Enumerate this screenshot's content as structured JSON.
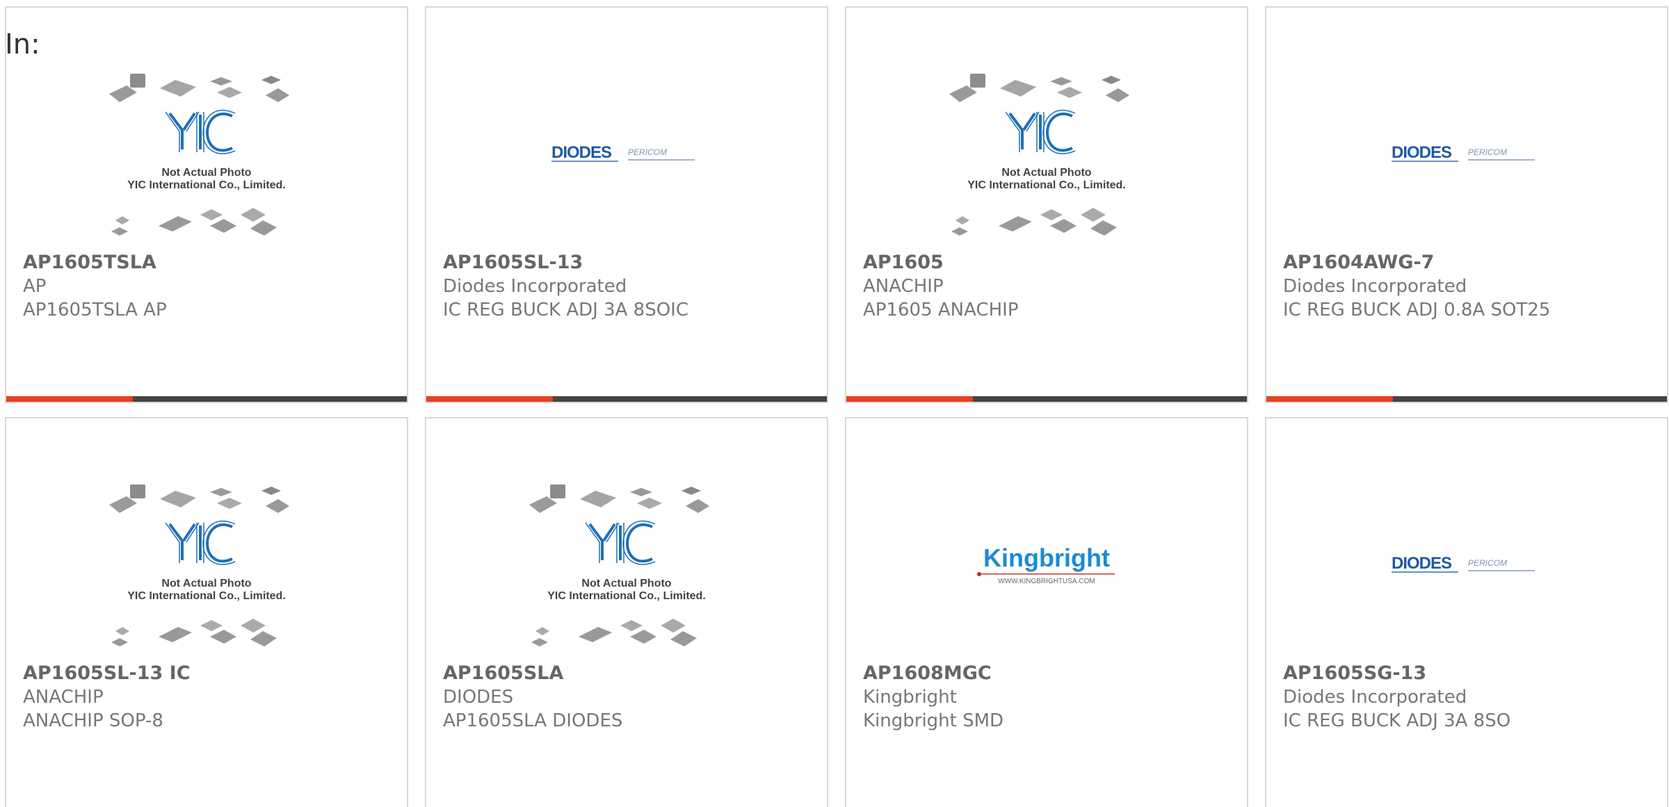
{
  "header": {
    "label": "In:"
  },
  "cards": [
    {
      "part": "AP1605TSLA",
      "manufacturer": "AP",
      "description": "AP1605TSLA AP",
      "image": "yic-placeholder",
      "caption1": "Not Actual Photo",
      "caption2": "YIC International Co., Limited."
    },
    {
      "part": "AP1605SL-13",
      "manufacturer": "Diodes Incorporated",
      "description": "IC REG BUCK ADJ 3A 8SOIC",
      "image": "diodes-logo",
      "brand1": "DIODES",
      "brand2": "PERICOM"
    },
    {
      "part": "AP1605",
      "manufacturer": "ANACHIP",
      "description": "AP1605 ANACHIP",
      "image": "yic-placeholder",
      "caption1": "Not Actual Photo",
      "caption2": "YIC International Co., Limited."
    },
    {
      "part": "AP1604AWG-7",
      "manufacturer": "Diodes Incorporated",
      "description": "IC REG BUCK ADJ 0.8A SOT25",
      "image": "diodes-logo",
      "brand1": "DIODES",
      "brand2": "PERICOM"
    },
    {
      "part": "AP1605SL-13 IC",
      "manufacturer": "ANACHIP",
      "description": "ANACHIP SOP-8",
      "image": "yic-placeholder",
      "caption1": "Not Actual Photo",
      "caption2": "YIC International Co., Limited."
    },
    {
      "part": "AP1605SLA",
      "manufacturer": "DIODES",
      "description": "AP1605SLA DIODES",
      "image": "yic-placeholder",
      "caption1": "Not Actual Photo",
      "caption2": "YIC International Co., Limited."
    },
    {
      "part": "AP1608MGC",
      "manufacturer": "Kingbright",
      "description": "Kingbright SMD",
      "image": "kingbright-logo",
      "brand1": "Kingbright",
      "brand2": "WWW.KINGBRIGHTUSA.COM"
    },
    {
      "part": "AP1605SG-13",
      "manufacturer": "Diodes Incorporated",
      "description": "IC REG BUCK ADJ 3A 8SO",
      "image": "diodes-logo",
      "brand1": "DIODES",
      "brand2": "PERICOM"
    }
  ],
  "colors": {
    "accent": "#e8401c",
    "bar": "#444444",
    "yic_blue": "#1e6fb8",
    "diodes_blue": "#1f5aa0",
    "kingbright_blue": "#1b8bd6"
  }
}
